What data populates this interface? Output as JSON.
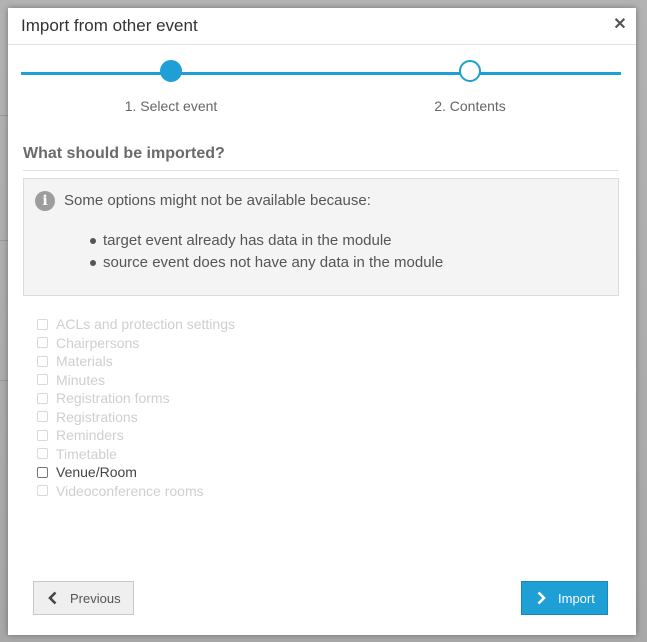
{
  "dialog": {
    "title": "Import from other event",
    "close_icon": "close-icon"
  },
  "stepper": {
    "steps": [
      {
        "label": "1. Select event",
        "state": "completed"
      },
      {
        "label": "2. Contents",
        "state": "current"
      }
    ],
    "color": "#1e9fd6"
  },
  "section": {
    "title": "What should be imported?"
  },
  "info": {
    "icon": "info-icon",
    "heading": "Some options might not be available because:",
    "reasons": [
      "target event already has data in the module",
      "source event does not have any data in the module"
    ]
  },
  "options": [
    {
      "label": "ACLs and protection settings",
      "enabled": false
    },
    {
      "label": "Chairpersons",
      "enabled": false
    },
    {
      "label": "Materials",
      "enabled": false
    },
    {
      "label": "Minutes",
      "enabled": false
    },
    {
      "label": "Registration forms",
      "enabled": false
    },
    {
      "label": "Registrations",
      "enabled": false
    },
    {
      "label": "Reminders",
      "enabled": false
    },
    {
      "label": "Timetable",
      "enabled": false
    },
    {
      "label": "Venue/Room",
      "enabled": true
    },
    {
      "label": "Videoconference rooms",
      "enabled": false
    }
  ],
  "buttons": {
    "previous_label": "Previous",
    "import_label": "Import"
  }
}
